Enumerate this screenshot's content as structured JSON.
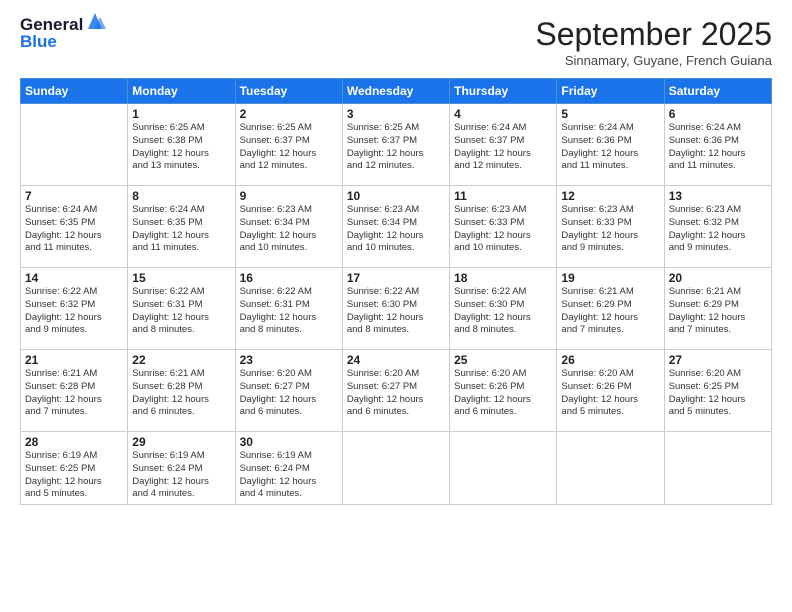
{
  "logo": {
    "line1": "General",
    "line2": "Blue"
  },
  "title": "September 2025",
  "subtitle": "Sinnamary, Guyane, French Guiana",
  "weekdays": [
    "Sunday",
    "Monday",
    "Tuesday",
    "Wednesday",
    "Thursday",
    "Friday",
    "Saturday"
  ],
  "weeks": [
    [
      {
        "day": "",
        "info": ""
      },
      {
        "day": "1",
        "info": "Sunrise: 6:25 AM\nSunset: 6:38 PM\nDaylight: 12 hours\nand 13 minutes."
      },
      {
        "day": "2",
        "info": "Sunrise: 6:25 AM\nSunset: 6:37 PM\nDaylight: 12 hours\nand 12 minutes."
      },
      {
        "day": "3",
        "info": "Sunrise: 6:25 AM\nSunset: 6:37 PM\nDaylight: 12 hours\nand 12 minutes."
      },
      {
        "day": "4",
        "info": "Sunrise: 6:24 AM\nSunset: 6:37 PM\nDaylight: 12 hours\nand 12 minutes."
      },
      {
        "day": "5",
        "info": "Sunrise: 6:24 AM\nSunset: 6:36 PM\nDaylight: 12 hours\nand 11 minutes."
      },
      {
        "day": "6",
        "info": "Sunrise: 6:24 AM\nSunset: 6:36 PM\nDaylight: 12 hours\nand 11 minutes."
      }
    ],
    [
      {
        "day": "7",
        "info": "Sunrise: 6:24 AM\nSunset: 6:35 PM\nDaylight: 12 hours\nand 11 minutes."
      },
      {
        "day": "8",
        "info": "Sunrise: 6:24 AM\nSunset: 6:35 PM\nDaylight: 12 hours\nand 11 minutes."
      },
      {
        "day": "9",
        "info": "Sunrise: 6:23 AM\nSunset: 6:34 PM\nDaylight: 12 hours\nand 10 minutes."
      },
      {
        "day": "10",
        "info": "Sunrise: 6:23 AM\nSunset: 6:34 PM\nDaylight: 12 hours\nand 10 minutes."
      },
      {
        "day": "11",
        "info": "Sunrise: 6:23 AM\nSunset: 6:33 PM\nDaylight: 12 hours\nand 10 minutes."
      },
      {
        "day": "12",
        "info": "Sunrise: 6:23 AM\nSunset: 6:33 PM\nDaylight: 12 hours\nand 9 minutes."
      },
      {
        "day": "13",
        "info": "Sunrise: 6:23 AM\nSunset: 6:32 PM\nDaylight: 12 hours\nand 9 minutes."
      }
    ],
    [
      {
        "day": "14",
        "info": "Sunrise: 6:22 AM\nSunset: 6:32 PM\nDaylight: 12 hours\nand 9 minutes."
      },
      {
        "day": "15",
        "info": "Sunrise: 6:22 AM\nSunset: 6:31 PM\nDaylight: 12 hours\nand 8 minutes."
      },
      {
        "day": "16",
        "info": "Sunrise: 6:22 AM\nSunset: 6:31 PM\nDaylight: 12 hours\nand 8 minutes."
      },
      {
        "day": "17",
        "info": "Sunrise: 6:22 AM\nSunset: 6:30 PM\nDaylight: 12 hours\nand 8 minutes."
      },
      {
        "day": "18",
        "info": "Sunrise: 6:22 AM\nSunset: 6:30 PM\nDaylight: 12 hours\nand 8 minutes."
      },
      {
        "day": "19",
        "info": "Sunrise: 6:21 AM\nSunset: 6:29 PM\nDaylight: 12 hours\nand 7 minutes."
      },
      {
        "day": "20",
        "info": "Sunrise: 6:21 AM\nSunset: 6:29 PM\nDaylight: 12 hours\nand 7 minutes."
      }
    ],
    [
      {
        "day": "21",
        "info": "Sunrise: 6:21 AM\nSunset: 6:28 PM\nDaylight: 12 hours\nand 7 minutes."
      },
      {
        "day": "22",
        "info": "Sunrise: 6:21 AM\nSunset: 6:28 PM\nDaylight: 12 hours\nand 6 minutes."
      },
      {
        "day": "23",
        "info": "Sunrise: 6:20 AM\nSunset: 6:27 PM\nDaylight: 12 hours\nand 6 minutes."
      },
      {
        "day": "24",
        "info": "Sunrise: 6:20 AM\nSunset: 6:27 PM\nDaylight: 12 hours\nand 6 minutes."
      },
      {
        "day": "25",
        "info": "Sunrise: 6:20 AM\nSunset: 6:26 PM\nDaylight: 12 hours\nand 6 minutes."
      },
      {
        "day": "26",
        "info": "Sunrise: 6:20 AM\nSunset: 6:26 PM\nDaylight: 12 hours\nand 5 minutes."
      },
      {
        "day": "27",
        "info": "Sunrise: 6:20 AM\nSunset: 6:25 PM\nDaylight: 12 hours\nand 5 minutes."
      }
    ],
    [
      {
        "day": "28",
        "info": "Sunrise: 6:19 AM\nSunset: 6:25 PM\nDaylight: 12 hours\nand 5 minutes."
      },
      {
        "day": "29",
        "info": "Sunrise: 6:19 AM\nSunset: 6:24 PM\nDaylight: 12 hours\nand 4 minutes."
      },
      {
        "day": "30",
        "info": "Sunrise: 6:19 AM\nSunset: 6:24 PM\nDaylight: 12 hours\nand 4 minutes."
      },
      {
        "day": "",
        "info": ""
      },
      {
        "day": "",
        "info": ""
      },
      {
        "day": "",
        "info": ""
      },
      {
        "day": "",
        "info": ""
      }
    ]
  ]
}
